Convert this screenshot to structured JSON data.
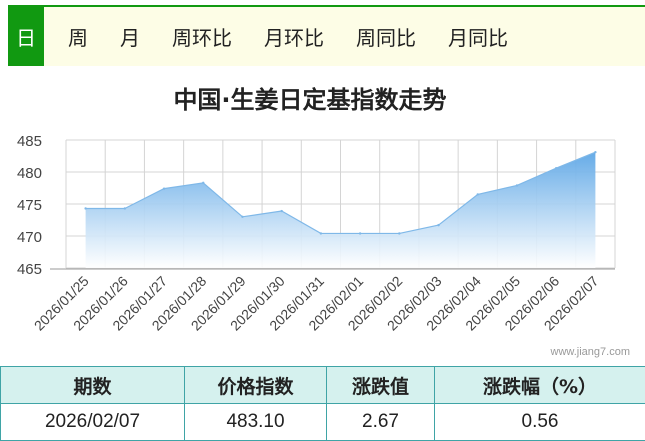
{
  "tabs": [
    {
      "label": "日",
      "active": true
    },
    {
      "label": "周"
    },
    {
      "label": "月"
    },
    {
      "label": "周环比"
    },
    {
      "label": "月环比"
    },
    {
      "label": "周同比"
    },
    {
      "label": "月同比"
    }
  ],
  "watermark": "www.jiang7.com",
  "colors": {
    "accent": "#119911",
    "series": "#7fb8e8",
    "table_border": "#3fa4a6",
    "table_header_bg": "#d5f1ee"
  },
  "chart_data": {
    "type": "area",
    "title": "中国·生姜日定基指数走势",
    "x": [
      "2026/01/25",
      "2026/01/26",
      "2026/01/27",
      "2026/01/28",
      "2026/01/29",
      "2026/01/30",
      "2026/01/31",
      "2026/02/01",
      "2026/02/02",
      "2026/02/03",
      "2026/02/04",
      "2026/02/05",
      "2026/02/06",
      "2026/02/07"
    ],
    "series": [
      {
        "values": [
          474.3,
          474.3,
          477.4,
          478.3,
          473.0,
          473.9,
          470.4,
          470.4,
          470.4,
          471.7,
          476.5,
          477.9,
          480.6,
          483.1
        ]
      }
    ],
    "yticks": [
      465,
      470,
      475,
      480,
      485
    ],
    "ylim": [
      465,
      485
    ],
    "grid": true,
    "legend": "none"
  },
  "summary": {
    "headers": [
      "期数",
      "价格指数",
      "涨跌值",
      "涨跌幅（%）"
    ],
    "values": [
      "2026/02/07",
      "483.10",
      "2.67",
      "0.56"
    ]
  }
}
